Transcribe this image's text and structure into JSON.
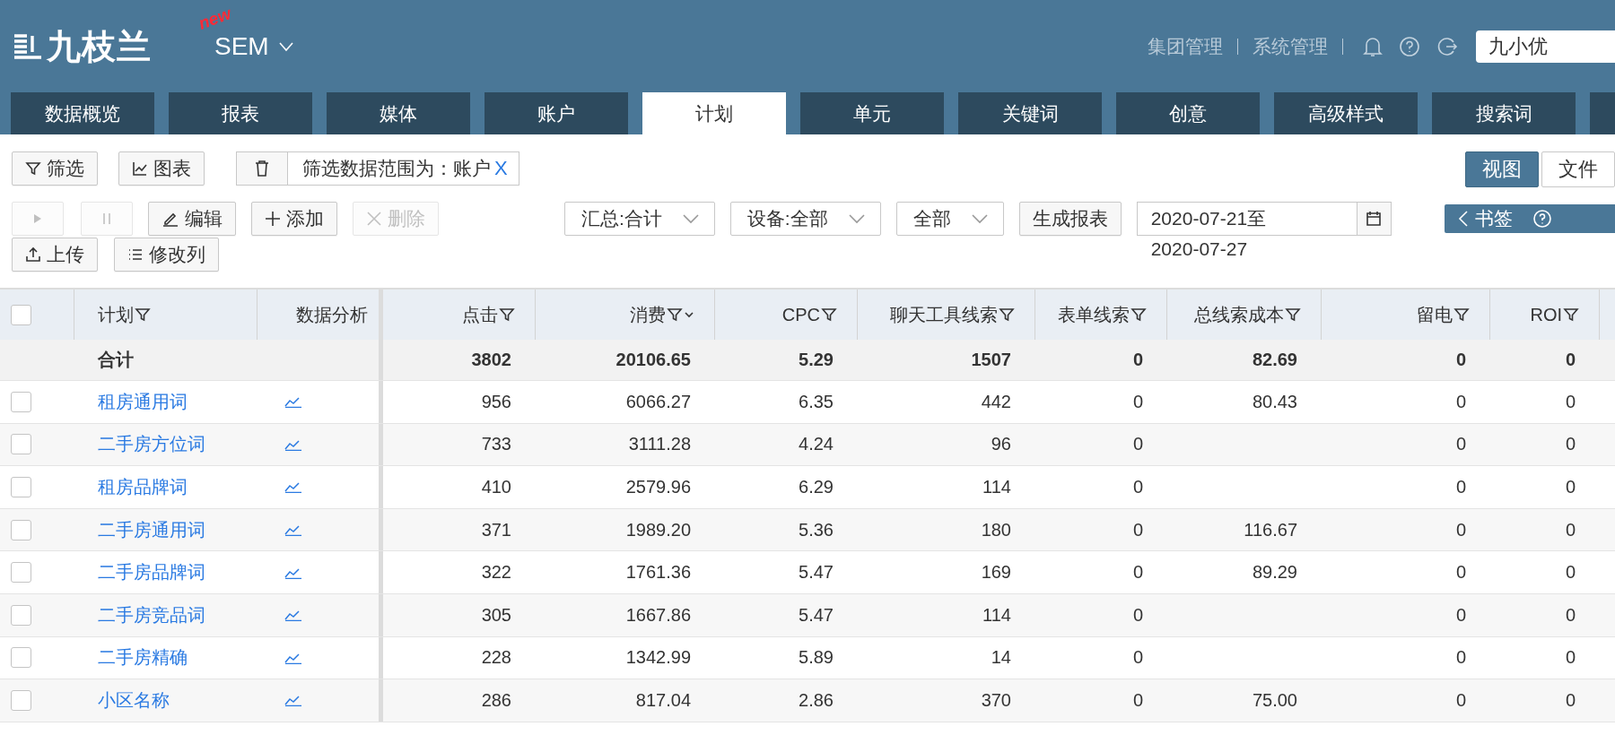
{
  "header": {
    "logo": "九枝兰",
    "badge": "new",
    "product": "SEM",
    "links": [
      "集团管理",
      "系统管理"
    ],
    "user_field": {
      "value": "九小优"
    }
  },
  "tabs": [
    {
      "label": "数据概览",
      "selected": false
    },
    {
      "label": "报表",
      "selected": false
    },
    {
      "label": "媒体",
      "selected": false
    },
    {
      "label": "账户",
      "selected": false
    },
    {
      "label": "计划",
      "selected": true
    },
    {
      "label": "单元",
      "selected": false
    },
    {
      "label": "关键词",
      "selected": false
    },
    {
      "label": "创意",
      "selected": false
    },
    {
      "label": "高级样式",
      "selected": false
    },
    {
      "label": "搜索词",
      "selected": false
    },
    {
      "selected": false
    }
  ],
  "toolbar": {
    "buttons": [
      {
        "kind": "filter",
        "label": "筛选"
      },
      {
        "kind": "chart",
        "label": "图表"
      }
    ],
    "scope_tag": {
      "text": "筛选数据范围为：账户",
      "remove": "X"
    },
    "view_toggle": [
      {
        "label": "视图",
        "selected": true
      },
      {
        "label": "文件",
        "selected": false
      }
    ],
    "actions": [
      {
        "kind": "play",
        "disabled": true
      },
      {
        "kind": "pause",
        "disabled": true
      },
      {
        "kind": "edit",
        "label": "编辑",
        "disabled": false
      },
      {
        "kind": "add",
        "label": "添加",
        "disabled": false
      },
      {
        "kind": "delete",
        "label": "删除",
        "disabled": true
      }
    ],
    "selects": [
      {
        "value": "汇总:合计"
      },
      {
        "value": "设备:全部"
      },
      {
        "value": "全部"
      }
    ],
    "report_button": "生成报表",
    "date_range": "2020-07-21至2020-07-27",
    "bookmark": "书签",
    "secondary_actions": [
      {
        "kind": "upload",
        "label": "上传"
      },
      {
        "kind": "columns",
        "label": "修改列"
      }
    ]
  },
  "table": {
    "select_all": {
      "checked": false
    },
    "columns": [
      {
        "label": "计划",
        "filter": true,
        "sorted": false
      },
      {
        "label": "数据分析",
        "filter": false,
        "sorted": false
      },
      {
        "label": "点击",
        "filter": true,
        "sorted": false
      },
      {
        "label": "消费",
        "filter": true,
        "sorted": true
      },
      {
        "label": "CPC",
        "filter": true,
        "sorted": false
      },
      {
        "label": "聊天工具线索",
        "filter": true,
        "sorted": false
      },
      {
        "label": "表单线索",
        "filter": true,
        "sorted": false
      },
      {
        "label": "总线索成本",
        "filter": true,
        "sorted": false
      },
      {
        "label": "留电",
        "filter": true,
        "sorted": false
      },
      {
        "label": "ROI",
        "filter": true,
        "sorted": false
      }
    ],
    "total": {
      "label": "合计",
      "clicks": "3802",
      "cost": "20106.65",
      "cpc": "5.29",
      "chat_leads": "1507",
      "form_leads": "0",
      "lead_cost": "82.69",
      "calls": "0",
      "roi": "0"
    },
    "rows": [
      {
        "checked": false,
        "name": "租房通用词",
        "clicks": "956",
        "cost": "6066.27",
        "cpc": "6.35",
        "chat_leads": "442",
        "form_leads": "0",
        "lead_cost": "80.43",
        "calls": "0",
        "roi": "0"
      },
      {
        "checked": false,
        "name": "二手房方位词",
        "clicks": "733",
        "cost": "3111.28",
        "cpc": "4.24",
        "chat_leads": "96",
        "form_leads": "0",
        "calls": "0",
        "roi": "0"
      },
      {
        "checked": false,
        "name": "租房品牌词",
        "clicks": "410",
        "cost": "2579.96",
        "cpc": "6.29",
        "chat_leads": "114",
        "form_leads": "0",
        "calls": "0",
        "roi": "0"
      },
      {
        "checked": false,
        "name": "二手房通用词",
        "clicks": "371",
        "cost": "1989.20",
        "cpc": "5.36",
        "chat_leads": "180",
        "form_leads": "0",
        "lead_cost": "116.67",
        "calls": "0",
        "roi": "0"
      },
      {
        "checked": false,
        "name": "二手房品牌词",
        "clicks": "322",
        "cost": "1761.36",
        "cpc": "5.47",
        "chat_leads": "169",
        "form_leads": "0",
        "lead_cost": "89.29",
        "calls": "0",
        "roi": "0"
      },
      {
        "checked": false,
        "name": "二手房竞品词",
        "clicks": "305",
        "cost": "1667.86",
        "cpc": "5.47",
        "chat_leads": "114",
        "form_leads": "0",
        "calls": "0",
        "roi": "0"
      },
      {
        "checked": false,
        "name": "二手房精确",
        "clicks": "228",
        "cost": "1342.99",
        "cpc": "5.89",
        "chat_leads": "14",
        "form_leads": "0",
        "calls": "0",
        "roi": "0"
      },
      {
        "checked": false,
        "name": "小区名称",
        "clicks": "286",
        "cost": "817.04",
        "cpc": "2.86",
        "chat_leads": "370",
        "form_leads": "0",
        "lead_cost": "75.00",
        "calls": "0",
        "roi": "0"
      }
    ]
  }
}
